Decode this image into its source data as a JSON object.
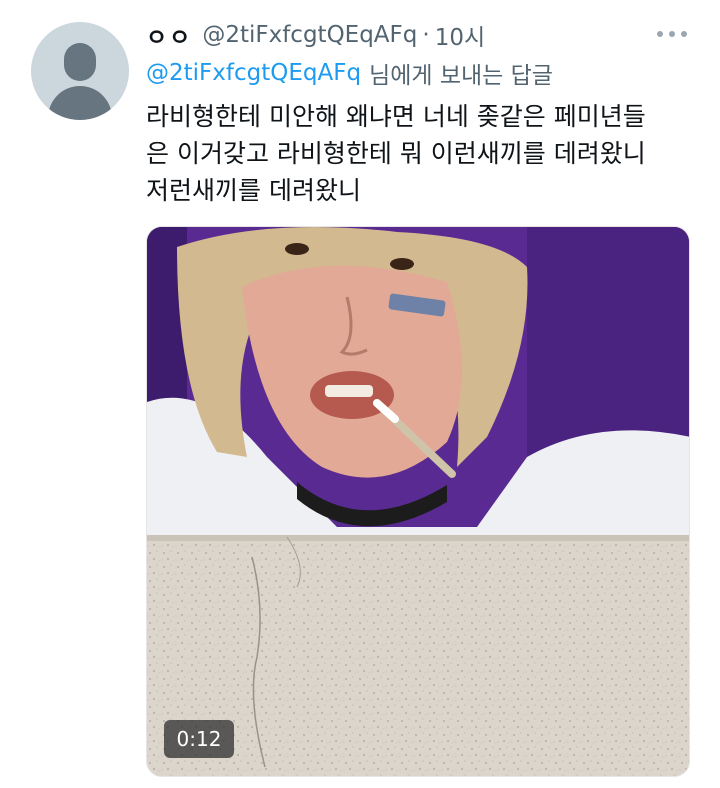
{
  "tweet": {
    "display_name": "ㅇㅇ",
    "handle": "@2tiFxfcgtQEqAFq",
    "separator": "·",
    "time": "10시",
    "reply": {
      "handle": "@2tiFxfcgtQEqAFq",
      "suffix": "님에게 보내는 답글"
    },
    "text_lines": [
      "라비형한테 미안해 왜냐면 너네 좆같은 페미년들",
      "은 이거갖고 라비형한테 뭐 이런새끼를 데려왔니",
      "저런새끼를 데려왔니"
    ],
    "media": {
      "type": "video",
      "duration": "0:12"
    }
  },
  "icons": {
    "more": "more-horizontal-icon",
    "avatar": "default-avatar-icon"
  },
  "colors": {
    "link": "#1d9bf0",
    "secondary_text": "#536471",
    "primary_text": "#0f1419",
    "avatar_bg": "#ccd6dd"
  }
}
